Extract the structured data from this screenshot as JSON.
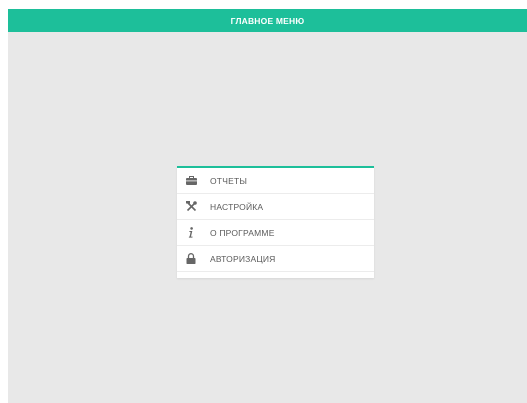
{
  "header": {
    "title": "ГЛАВНОЕ МЕНЮ",
    "color": "#1dbf9a"
  },
  "menu": {
    "items": [
      {
        "label": "ОТЧЕТЫ",
        "icon": "briefcase-icon"
      },
      {
        "label": "НАСТРОЙКА",
        "icon": "tools-icon"
      },
      {
        "label": "О ПРОГРАММЕ",
        "icon": "info-icon"
      },
      {
        "label": "АВТОРИЗАЦИЯ",
        "icon": "lock-icon"
      }
    ]
  }
}
